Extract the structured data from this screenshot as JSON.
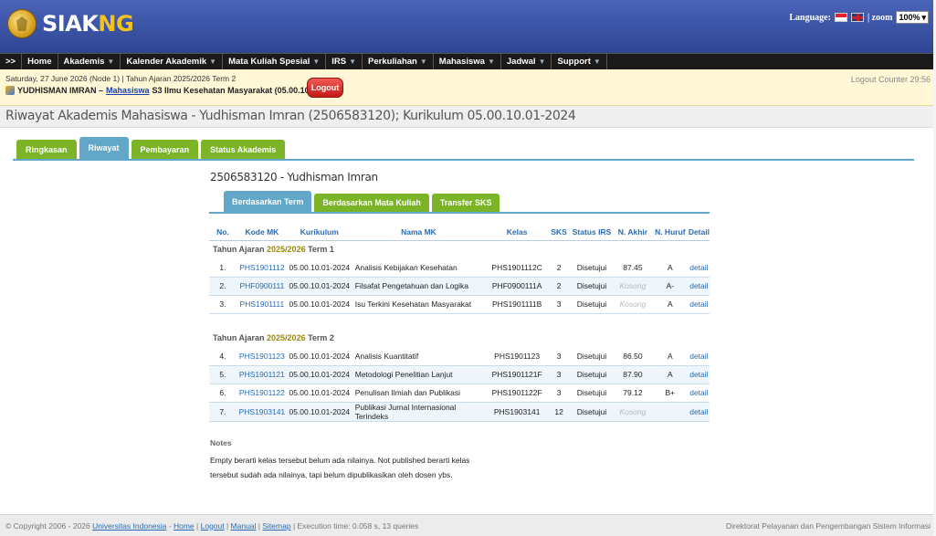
{
  "header": {
    "logo_main": "SIAK",
    "logo_accent": "NG",
    "language_label": "Language:",
    "zoom_label": "| zoom",
    "zoom_value": "100%"
  },
  "nav": [
    {
      "label": ">>",
      "caret": false
    },
    {
      "label": "Home",
      "caret": false
    },
    {
      "label": "Akademis",
      "caret": true
    },
    {
      "label": "Kalender Akademik",
      "caret": true
    },
    {
      "label": "Mata Kuliah Spesial",
      "caret": true
    },
    {
      "label": "IRS",
      "caret": true
    },
    {
      "label": "Perkuliahan",
      "caret": true
    },
    {
      "label": "Mahasiswa",
      "caret": true
    },
    {
      "label": "Jadwal",
      "caret": true
    },
    {
      "label": "Support",
      "caret": true
    }
  ],
  "info": {
    "date_line": "Saturday, 27 June 2026 (Node 1) | Tahun Ajaran 2025/2026 Term 2",
    "user_name": "YUDHISMAN IMRAN –",
    "user_role": "Mahasiswa",
    "user_program": "S3 Ilmu Kesehatan Masyarakat (05.00.10.01)",
    "logout_label": "Logout",
    "logout_counter": "Logout Counter 29:56"
  },
  "page_title": "Riwayat Akademis Mahasiswa - Yudhisman Imran (2506583120); Kurikulum 05.00.10.01-2024",
  "tabs": [
    {
      "label": "Ringkasan",
      "active": false
    },
    {
      "label": "Riwayat",
      "active": true
    },
    {
      "label": "Pembayaran",
      "active": false
    },
    {
      "label": "Status Akademis",
      "active": false
    }
  ],
  "student_heading": "2506583120 - Yudhisman Imran",
  "subtabs": [
    {
      "label": "Berdasarkan Term",
      "active": true
    },
    {
      "label": "Berdasarkan Mata Kuliah",
      "active": false
    },
    {
      "label": "Transfer SKS",
      "active": false
    }
  ],
  "table": {
    "columns": [
      "No.",
      "Kode MK",
      "Kurikulum",
      "Nama MK",
      "Kelas",
      "SKS",
      "Status IRS",
      "N. Akhir",
      "N. Huruf",
      "Detail"
    ],
    "groups": [
      {
        "prefix": "Tahun Ajaran",
        "year": "2025/2026",
        "term": "Term 1",
        "rows": [
          {
            "no": "1.",
            "kode": "PHS1901112",
            "kurikulum": "05.00.10.01-2024",
            "nama": "Analisis Kebijakan Kesehatan",
            "kelas": "PHS1901112C",
            "sks": "2",
            "status": "Disetujui",
            "nakhir": "87.45",
            "nhuruf": "A",
            "detail": "detail"
          },
          {
            "no": "2.",
            "kode": "PHF0900111",
            "kurikulum": "05.00.10.01-2024",
            "nama": "Filsafat Pengetahuan dan Logika",
            "kelas": "PHF0900111A",
            "sks": "2",
            "status": "Disetujui",
            "nakhir": "Kosong",
            "nhuruf": "A-",
            "detail": "detail"
          },
          {
            "no": "3.",
            "kode": "PHS1901111",
            "kurikulum": "05.00.10.01-2024",
            "nama": "Isu Terkini Kesehatan Masyarakat",
            "kelas": "PHS1901111B",
            "sks": "3",
            "status": "Disetujui",
            "nakhir": "Kosong",
            "nhuruf": "A",
            "detail": "detail"
          }
        ]
      },
      {
        "prefix": "Tahun Ajaran",
        "year": "2025/2026",
        "term": "Term 2",
        "rows": [
          {
            "no": "4.",
            "kode": "PHS1901123",
            "kurikulum": "05.00.10.01-2024",
            "nama": "Analisis Kuantitatif",
            "kelas": "PHS1901123",
            "sks": "3",
            "status": "Disetujui",
            "nakhir": "86.50",
            "nhuruf": "A",
            "detail": "detail"
          },
          {
            "no": "5.",
            "kode": "PHS1901121",
            "kurikulum": "05.00.10.01-2024",
            "nama": "Metodologi Penelitian Lanjut",
            "kelas": "PHS1901121F",
            "sks": "3",
            "status": "Disetujui",
            "nakhir": "87.90",
            "nhuruf": "A",
            "detail": "detail"
          },
          {
            "no": "6.",
            "kode": "PHS1901122",
            "kurikulum": "05.00.10.01-2024",
            "nama": "Penulisan Ilmiah dan Publikasi",
            "kelas": "PHS1901122F",
            "sks": "3",
            "status": "Disetujui",
            "nakhir": "79.12",
            "nhuruf": "B+",
            "detail": "detail"
          },
          {
            "no": "7.",
            "kode": "PHS1903141",
            "kurikulum": "05.00.10.01-2024",
            "nama": "Publikasi Jurnal Internasional Terindeks",
            "kelas": "PHS1903141",
            "sks": "12",
            "status": "Disetujui",
            "nakhir": "Kosong",
            "nhuruf": "",
            "detail": "detail"
          }
        ]
      }
    ]
  },
  "notes": {
    "title": "Notes",
    "text": "Empty berarti kelas tersebut belum ada nilainya. Not published berarti kelas tersebut sudah ada nilainya, tapi belum dipublikasikan oleh dosen ybs."
  },
  "footer": {
    "copyright": "© Copyright 2006 - 2026",
    "university": "Universitas Indonesia",
    "sep1": "-",
    "home": "Home",
    "logout": "Logout",
    "manual": "Manual",
    "sitemap": "Sitemap",
    "exec": "| Execution time: 0.058 s, 13 queries",
    "right": "Direktorat Pelayanan dan Pengembangan Sistem Informasi"
  }
}
